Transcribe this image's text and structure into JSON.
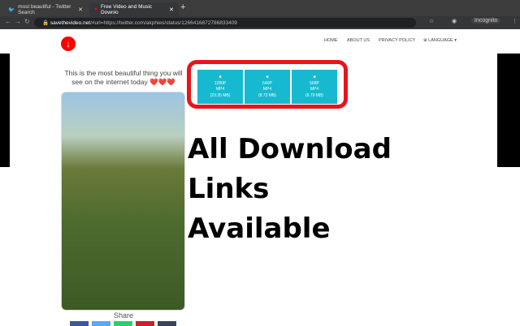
{
  "browser": {
    "tabs": [
      {
        "title": "most beautiful - Twitter Search",
        "icon": "twitter-icon"
      },
      {
        "title": "Free Video and Music Downlo",
        "icon": "savethevideo-icon"
      }
    ],
    "url_domain": "savethevideo.net",
    "url_path": "/#url=https://twitter.com/akphies/status/1266416872786833409",
    "profile": "Incognito"
  },
  "nav": {
    "home": "HOME",
    "about": "ABOUT US",
    "privacy": "PRIVACY POLICY",
    "language": "LANGUAGE"
  },
  "video": {
    "caption": "This is the most beautiful thing you will see on the internet today ❤️❤️❤️",
    "share_label": "Share"
  },
  "downloads": [
    {
      "res": "1280P",
      "fmt": "MP4",
      "size": "(23.35 MB)"
    },
    {
      "res": "640P",
      "fmt": "MP4",
      "size": "(8.73 MB)"
    },
    {
      "res": "568P",
      "fmt": "MP4",
      "size": "(6.79 MB)"
    }
  ],
  "overlay_text": [
    "All Download",
    "Links",
    "Available"
  ],
  "colors": {
    "accent": "#17b9d1",
    "highlight": "#e8141c"
  }
}
